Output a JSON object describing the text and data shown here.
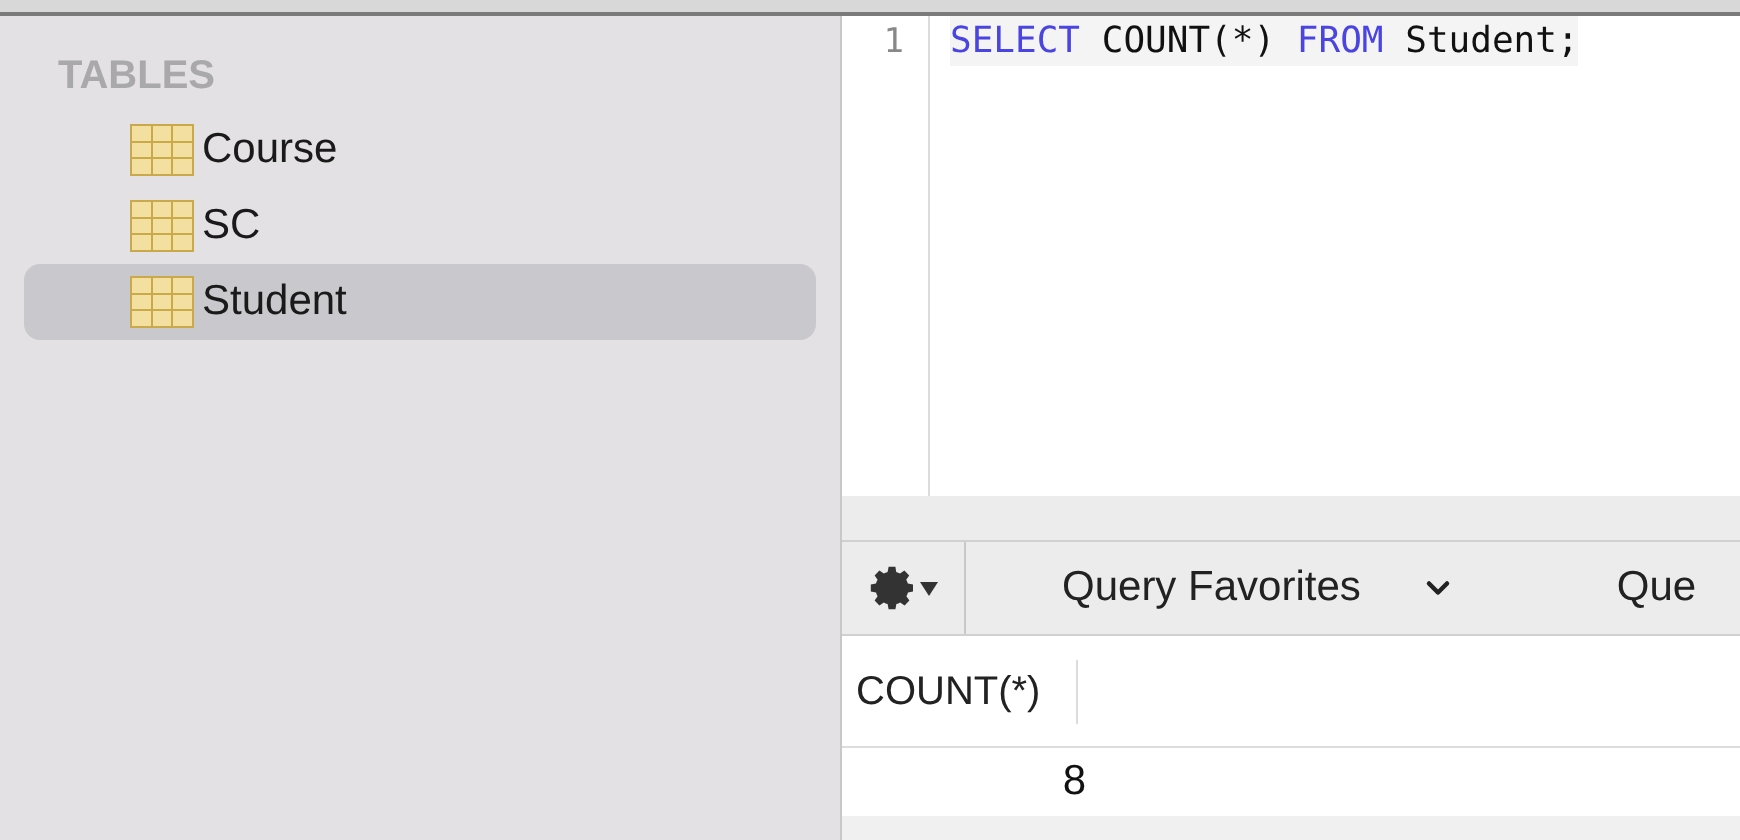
{
  "sidebar": {
    "heading": "TABLES",
    "items": [
      {
        "label": "Course",
        "selected": false
      },
      {
        "label": "SC",
        "selected": false
      },
      {
        "label": "Student",
        "selected": true
      }
    ]
  },
  "editor": {
    "lines": [
      {
        "number": "1",
        "tokens": [
          {
            "text": "SELECT",
            "kind": "keyword"
          },
          {
            "text": " COUNT(*) ",
            "kind": "plain"
          },
          {
            "text": "FROM",
            "kind": "keyword"
          },
          {
            "text": " Student;",
            "kind": "plain"
          }
        ]
      }
    ]
  },
  "toolbar": {
    "favorites": "Query Favorites",
    "history": "Que"
  },
  "results": {
    "columns": [
      "COUNT(*)"
    ],
    "rows": [
      [
        "8"
      ]
    ]
  }
}
